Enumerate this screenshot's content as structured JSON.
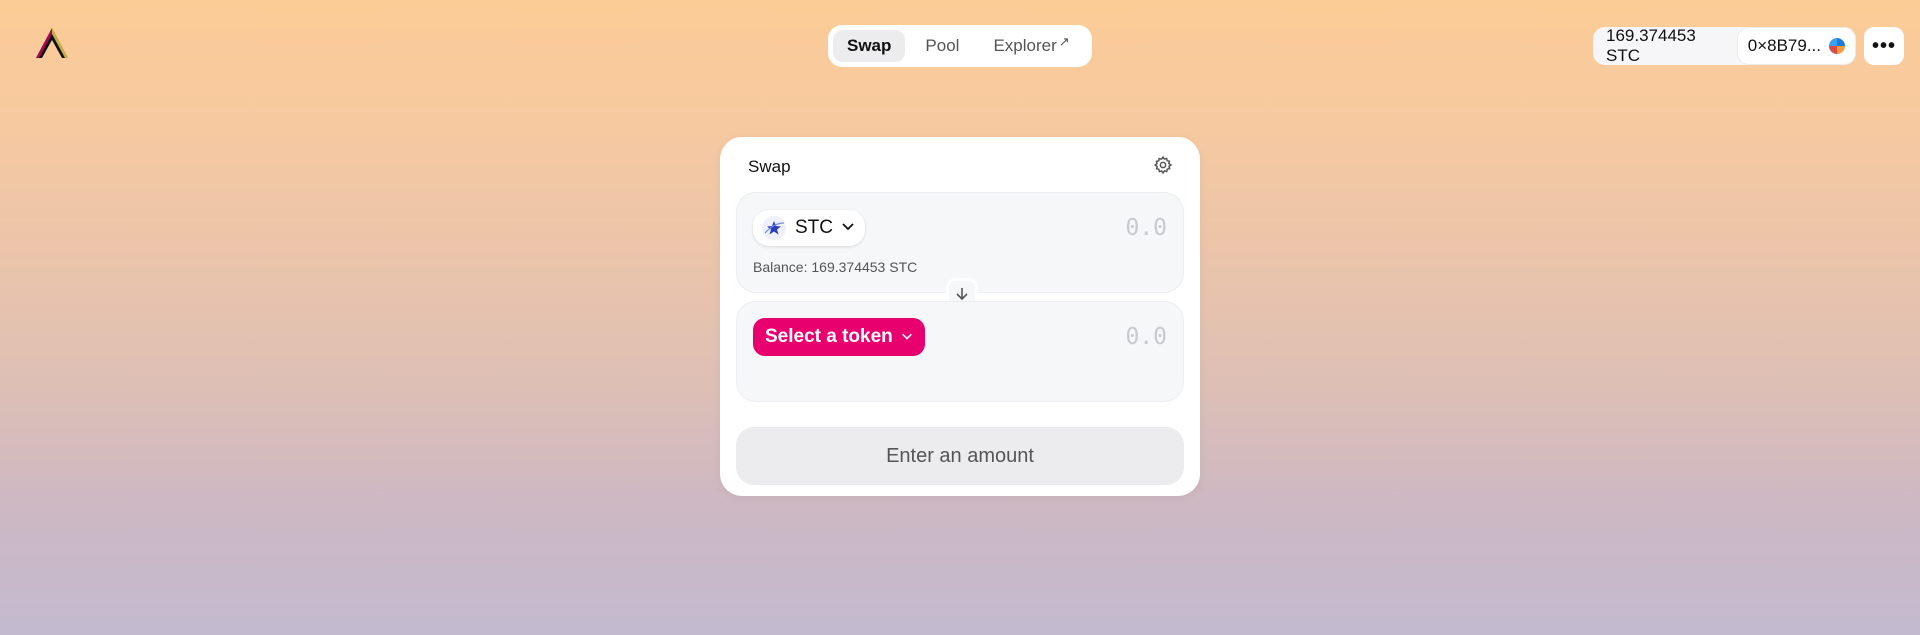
{
  "header": {
    "logo_icon": "app-logo-icon",
    "nav": [
      {
        "label": "Swap",
        "active": true
      },
      {
        "label": "Pool",
        "active": false
      },
      {
        "label": "Explorer",
        "active": false,
        "external_icon": "↗"
      }
    ],
    "account": {
      "balance": "169.374453 STC",
      "address": "0×8B79...",
      "avatar_icon": "identicon-icon"
    },
    "more_label": "•••"
  },
  "swap": {
    "title": "Swap",
    "settings_icon": "gear-icon",
    "input": {
      "token_symbol": "STC",
      "amount_placeholder": "0.0",
      "balance_label": "Balance: 169.374453 STC"
    },
    "switch_icon": "arrow-down-icon",
    "output": {
      "select_label": "Select a token",
      "amount_placeholder": "0.0"
    },
    "action_label": "Enter an amount"
  },
  "colors": {
    "accent": "#e8006f",
    "card": "#ffffff",
    "panel": "#f6f7f9"
  }
}
